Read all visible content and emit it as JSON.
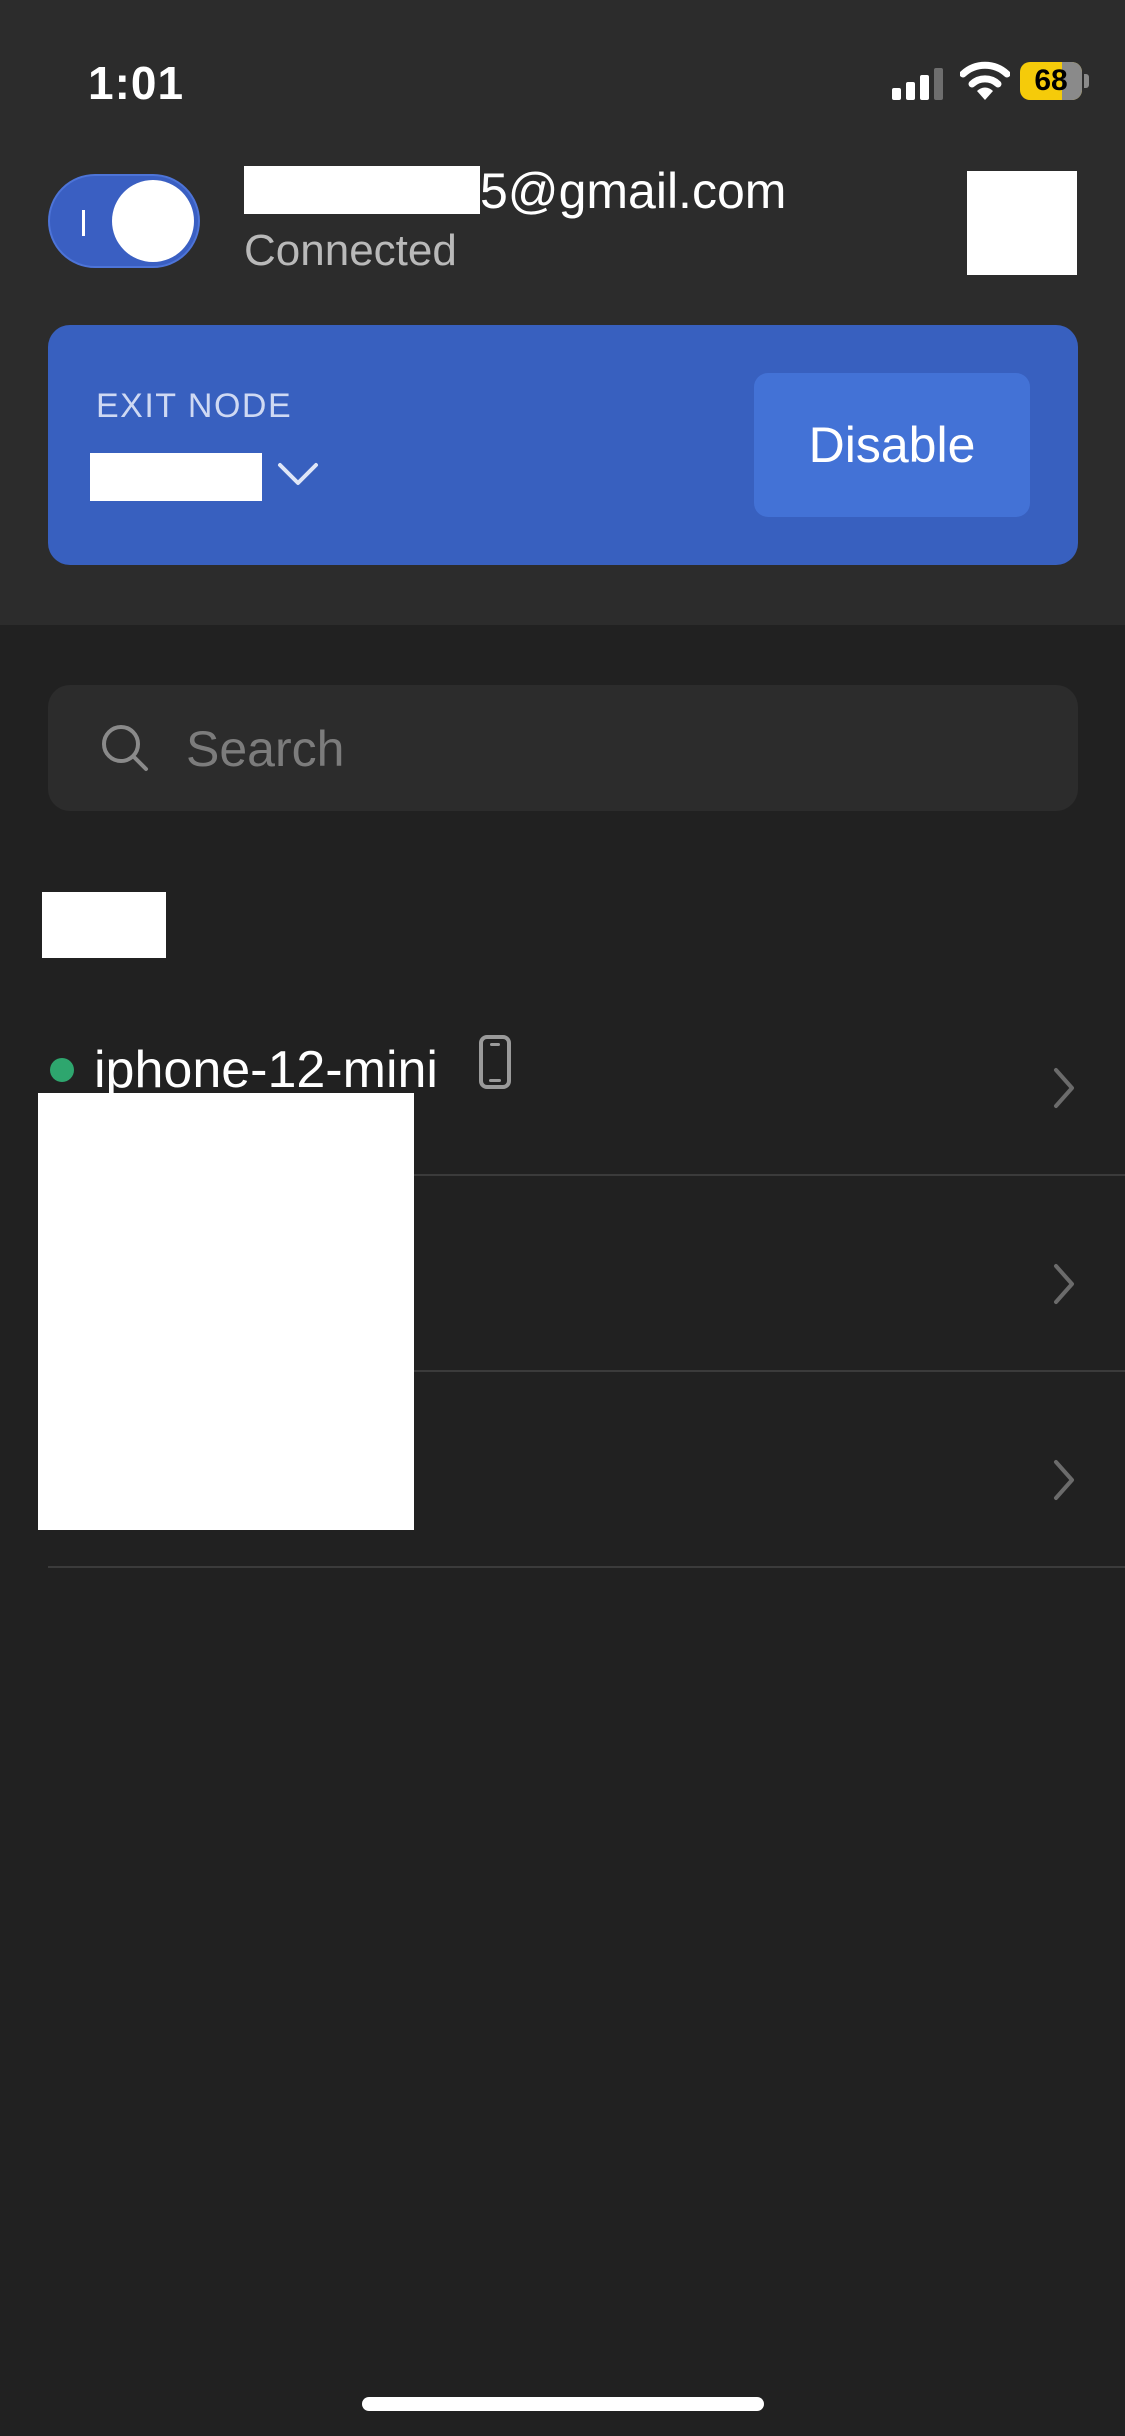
{
  "status_bar": {
    "time": "1:01",
    "battery_level": "68",
    "battery_color": "#f5cb0a"
  },
  "header": {
    "email_visible_suffix": "5@gmail.com",
    "connection_status": "Connected",
    "vpn_enabled": true,
    "accent_color": "#3a5fc2"
  },
  "exit_node": {
    "label": "EXIT NODE",
    "action_label": "Disable"
  },
  "search": {
    "placeholder": "Search"
  },
  "devices": [
    {
      "name": "iphone-12-mini",
      "online": true,
      "icon": "phone-icon",
      "status_color": "#2ea66e"
    },
    {
      "name": "",
      "online": false,
      "icon": ""
    },
    {
      "name": "",
      "online": false,
      "icon": ""
    }
  ]
}
